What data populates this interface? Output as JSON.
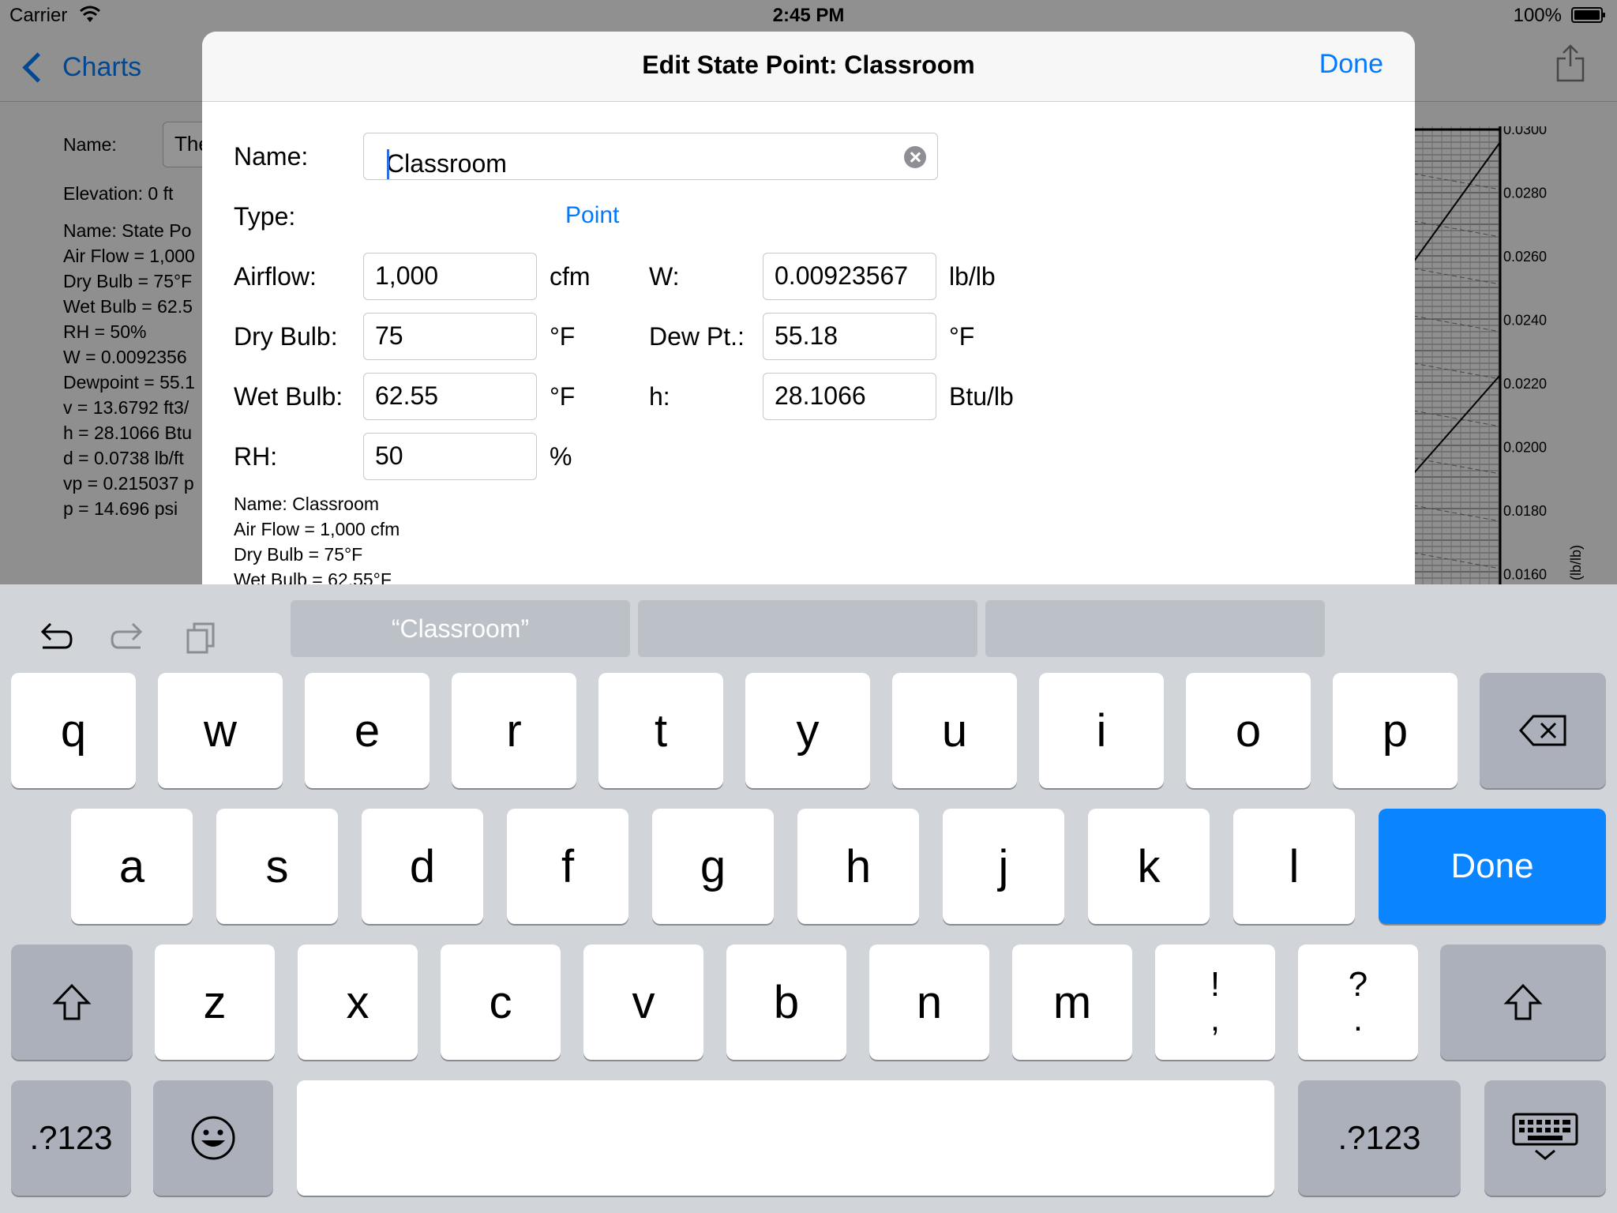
{
  "status_bar": {
    "carrier": "Carrier",
    "time": "2:45 PM",
    "battery": "100%"
  },
  "background": {
    "back_label": "Charts",
    "name_label": "Name:",
    "name_value_partial": "The",
    "elevation": "Elevation:  0 ft",
    "lines": [
      "Name: State Po",
      "Air Flow = 1,000",
      "Dry Bulb = 75°F",
      "Wet Bulb = 62.5",
      "RH = 50%",
      "W = 0.0092356",
      "Dewpoint = 55.1",
      "v = 13.6792 ft3/",
      "h = 28.1066 Btu",
      "d = 0.0738 lb/ft",
      "vp = 0.215037 p",
      "p = 14.696 psi"
    ],
    "chart": {
      "ticks": [
        "0.0300",
        "0.0280",
        "0.0260",
        "0.0240",
        "0.0220",
        "0.0200",
        "0.0180",
        "0.0160"
      ],
      "axis_label": "(lb/lb)"
    }
  },
  "modal": {
    "title": "Edit State Point: Classroom",
    "done_label": "Done",
    "name_label": "Name:",
    "name_value": "Classroom",
    "type_label": "Type:",
    "type_value": "Point",
    "fields": {
      "airflow": {
        "label": "Airflow:",
        "value": "1,000",
        "unit": "cfm"
      },
      "dry_bulb": {
        "label": "Dry Bulb:",
        "value": "75",
        "unit": "°F"
      },
      "wet_bulb": {
        "label": "Wet Bulb:",
        "value": "62.55",
        "unit": "°F"
      },
      "rh": {
        "label": "RH:",
        "value": "50",
        "unit": "%"
      },
      "w": {
        "label": "W:",
        "value": "0.00923567",
        "unit": "lb/lb"
      },
      "dew_pt": {
        "label": "Dew Pt.:",
        "value": "55.18",
        "unit": "°F"
      },
      "h": {
        "label": "h:",
        "value": "28.1066",
        "unit": "Btu/lb"
      }
    },
    "summary": [
      "Name: Classroom",
      "Air Flow = 1,000 cfm",
      "Dry Bulb = 75°F",
      "Wet Bulb = 62.55°F"
    ]
  },
  "keyboard": {
    "suggestions": [
      "“Classroom”",
      "",
      ""
    ],
    "row1": [
      "q",
      "w",
      "e",
      "r",
      "t",
      "y",
      "u",
      "i",
      "o",
      "p"
    ],
    "row2": [
      "a",
      "s",
      "d",
      "f",
      "g",
      "h",
      "j",
      "k",
      "l"
    ],
    "row3": [
      "z",
      "x",
      "c",
      "v",
      "b",
      "n",
      "m",
      "!\n,",
      "?\n."
    ],
    "done_label": "Done",
    "numbers_label": ".?123"
  }
}
